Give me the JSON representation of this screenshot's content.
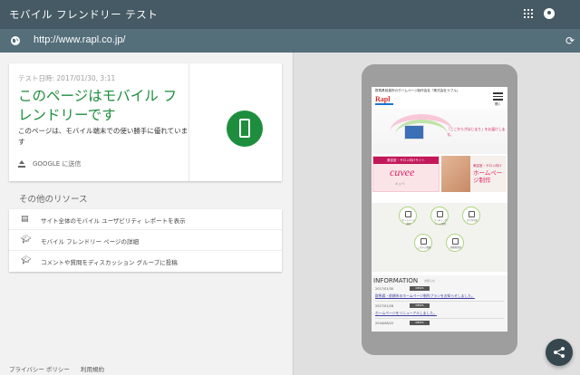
{
  "app": {
    "title": "モバイル フレンドリー テスト",
    "icons": [
      "apps-grid-icon",
      "account-icon"
    ]
  },
  "urlbar": {
    "url": "http://www.rapl.co.jp/",
    "icons": [
      "globe-icon",
      "refresh-icon"
    ]
  },
  "result": {
    "test_date": "テスト日時: 2017/01/30, 3:11",
    "title": "このページはモバイル フレンドリーです",
    "description": "このページは、モバイル端末での使い勝手に優れています",
    "send_label": "GOOGLE に送信",
    "status_color": "#1e8e3e"
  },
  "resources": {
    "title": "その他のリソース",
    "items": [
      {
        "label": "サイト全体のモバイル ユーザビリティ レポートを表示",
        "icon": "report-icon"
      },
      {
        "label": "モバイル フレンドリー ページの詳細",
        "icon": "school-icon"
      },
      {
        "label": "コメントや質問をディスカッション グループに投稿",
        "icon": "school-icon"
      }
    ]
  },
  "footer": {
    "privacy": "プライバシー ポリシー",
    "terms": "利用規約"
  },
  "preview": {
    "tagline": "群馬県前橋市のホームページ制作会社「株式会社ラプル」",
    "logo": "Rapl",
    "menu_label": "開く",
    "hero_copy": "「ここからがはじまり」をお届けします。",
    "banner_left_top": "美容室・サロン向けサイト",
    "banner_left_logo": "cuvee",
    "banner_left_sub": "キュベ",
    "banner_right_small": "美容室・サロン向け",
    "banner_right_big": "ホームページ制作",
    "services": [
      {
        "label": "ホームページ制作"
      },
      {
        "label": "ランディングページ制作"
      },
      {
        "label": "スマホ対応"
      },
      {
        "label": "システム開発"
      },
      {
        "label": "印刷物制作"
      }
    ],
    "info_title": "INFORMATION",
    "info_sub": "お知らせ",
    "news": [
      {
        "date": "2017/01/30",
        "tag": "NEWS",
        "text": "群馬県・前橋市のホームページ制作プランをお知らせしました。"
      },
      {
        "date": "2017/01/26",
        "tag": "NEWS",
        "text": "ホームページをリニューアルしました。"
      },
      {
        "date": "2016/08/22",
        "tag": "NEWS",
        "text": ""
      }
    ]
  },
  "fab": {
    "icon": "share-icon"
  }
}
